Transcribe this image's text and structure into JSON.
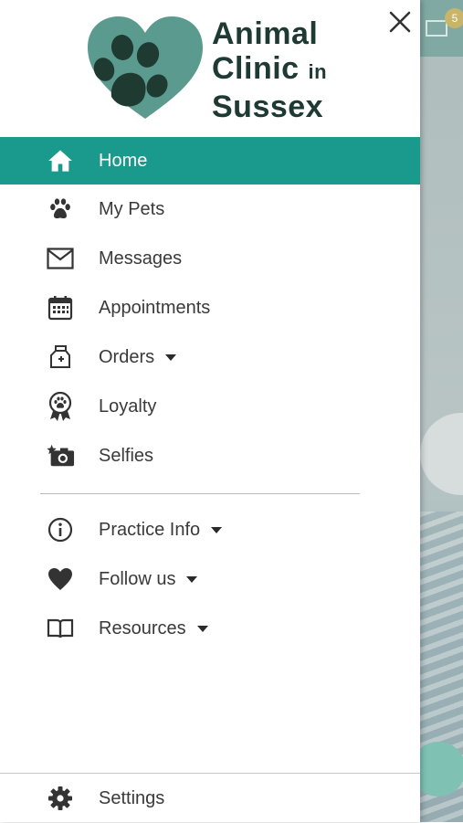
{
  "brand": {
    "line1": "Animal",
    "line2": "Clinic",
    "line2_small": "in",
    "line3": "Sussex",
    "colors": {
      "heart": "#5a9a8f",
      "paw": "#1f3a31",
      "accent": "#1a9a8c"
    }
  },
  "background": {
    "badge_count": "5"
  },
  "menu": {
    "primary": [
      {
        "label": "Home",
        "icon": "home-icon",
        "active": true
      },
      {
        "label": "My Pets",
        "icon": "paw-icon"
      },
      {
        "label": "Messages",
        "icon": "envelope-icon"
      },
      {
        "label": "Appointments",
        "icon": "calendar-icon"
      },
      {
        "label": "Orders",
        "icon": "medicine-bag-icon",
        "dropdown": true
      },
      {
        "label": "Loyalty",
        "icon": "award-ribbon-icon"
      },
      {
        "label": "Selfies",
        "icon": "camera-icon"
      }
    ],
    "secondary": [
      {
        "label": "Practice Info",
        "icon": "info-icon",
        "dropdown": true
      },
      {
        "label": "Follow us",
        "icon": "heart-icon",
        "dropdown": true
      },
      {
        "label": "Resources",
        "icon": "book-icon",
        "dropdown": true
      }
    ],
    "footer": {
      "label": "Settings",
      "icon": "gear-icon"
    }
  }
}
